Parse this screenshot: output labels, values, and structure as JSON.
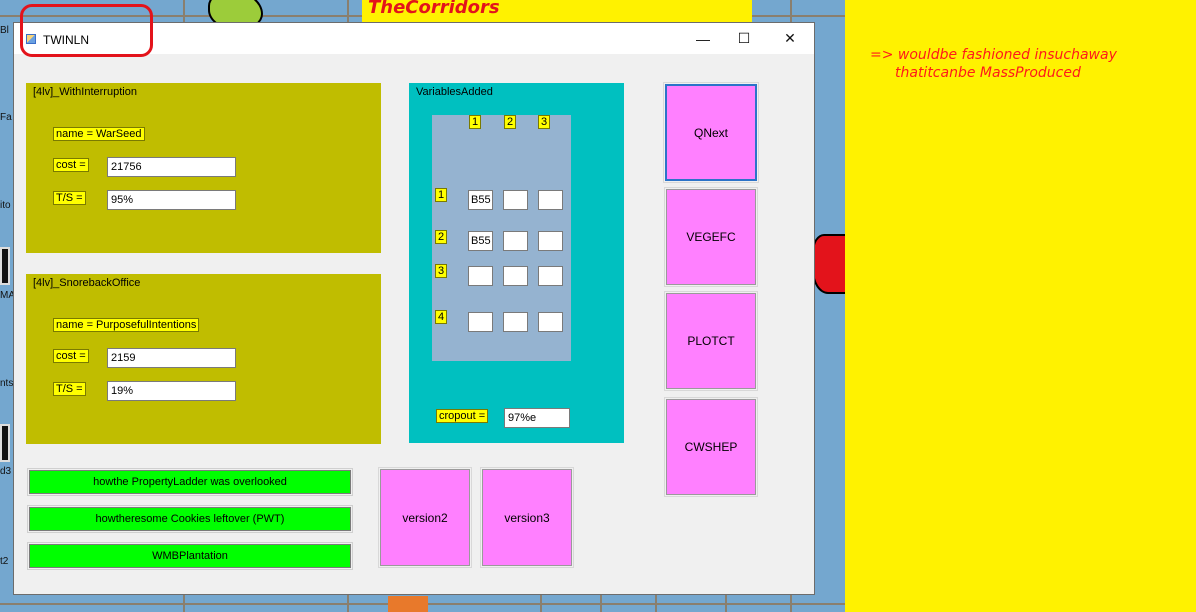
{
  "desktop": {
    "banner_top": "TheCorridors",
    "side_note_line1": "=> wouldbe fashioned insuchaway",
    "side_note_line2": "thatitcanbe MassProduced",
    "fragments": [
      "Bl",
      "Fa",
      "ito",
      "MA",
      "nts",
      "d3",
      "t2"
    ]
  },
  "window": {
    "title": "TWINLN",
    "minimize": "—",
    "maximize": "☐",
    "close": "✕"
  },
  "group1": {
    "title": "[4lv]_WithInterruption",
    "name_label": "name = WarSeed",
    "cost_label": "cost =",
    "cost_value": "21756",
    "ts_label": "T/S =",
    "ts_value": "95%"
  },
  "group2": {
    "title": "[4lv]_SnorebackOffice",
    "name_label": "name = PurposefulIntentions",
    "cost_label": "cost =",
    "cost_value": "2159",
    "ts_label": "T/S =",
    "ts_value": "19%"
  },
  "variables": {
    "title": "VariablesAdded",
    "col_headers": [
      "1",
      "2",
      "3"
    ],
    "row_headers": [
      "1",
      "2",
      "3",
      "4"
    ],
    "cells": [
      [
        "B55",
        "",
        ""
      ],
      [
        "B55",
        "",
        ""
      ],
      [
        "",
        "",
        ""
      ],
      [
        "",
        "",
        ""
      ]
    ],
    "cropout_label": "cropout =",
    "cropout_value": "97%e"
  },
  "buttons": {
    "qnext": "QNext",
    "vegefc": "VEGEFC",
    "plotct": "PLOTCT",
    "cwshep": "CWSHEP",
    "version2": "version2",
    "version3": "version3",
    "green1": "howthe PropertyLadder was overlooked",
    "green2": "howtheresome Cookies leftover (PWT)",
    "green3": "WMBPlantation"
  },
  "colors": {
    "olive": "#c0bd00",
    "teal": "#00c0c0",
    "matrix": "#95b3d0",
    "pink": "#ff80ff",
    "green": "#00ff00",
    "label_yellow": "#ffff00",
    "banner_yellow": "#fff200",
    "annotation_red": "#e3131b"
  }
}
